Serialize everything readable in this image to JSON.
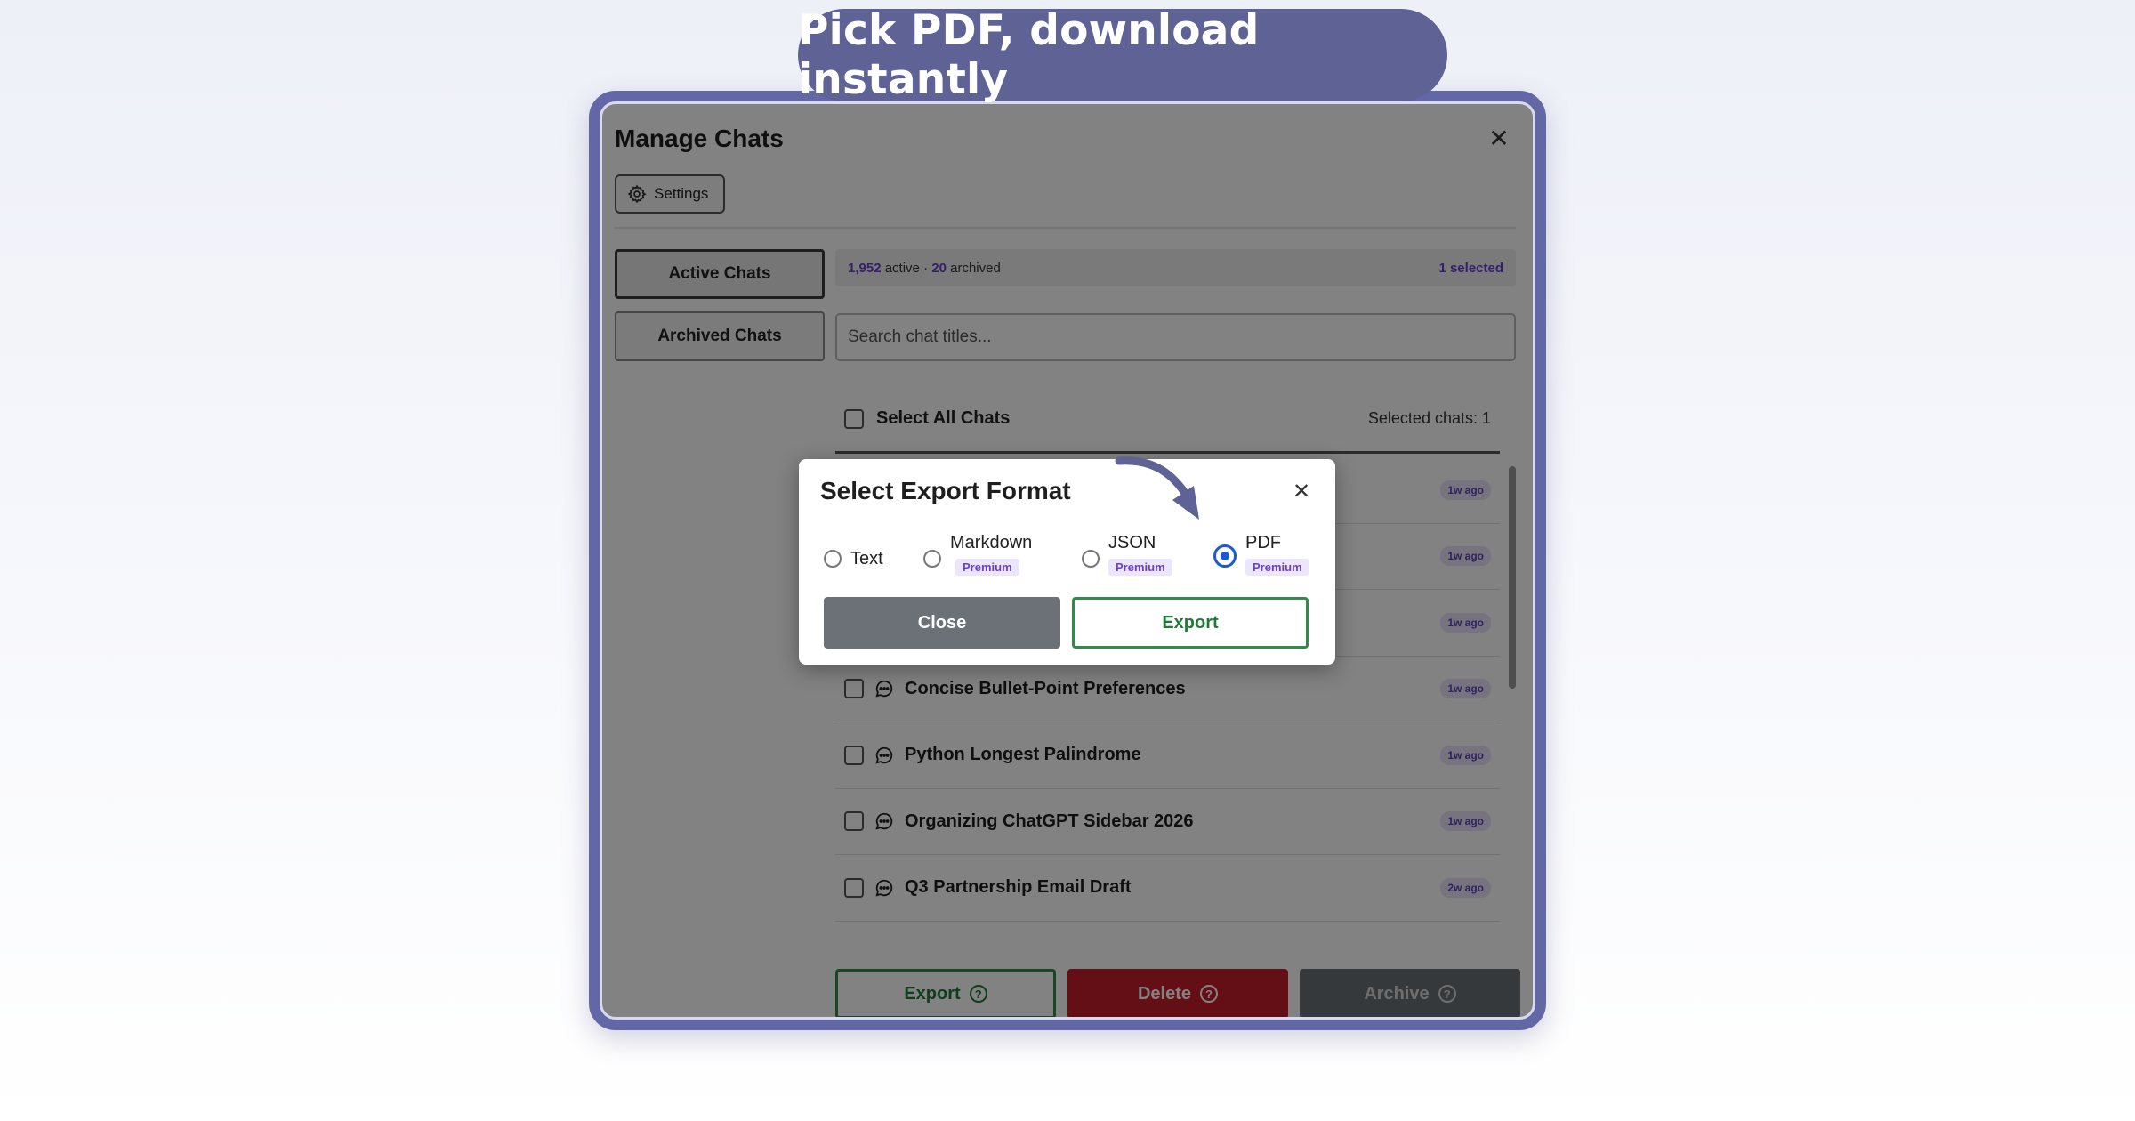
{
  "banner": {
    "text": "Pick PDF, download instantly"
  },
  "panel": {
    "title": "Manage Chats",
    "settings_label": "Settings",
    "tabs": [
      {
        "label": "Active Chats",
        "active": true
      },
      {
        "label": "Archived Chats",
        "active": false
      }
    ],
    "stats": {
      "active_count": "1,952",
      "active_label": "active ·",
      "archived_count": "20",
      "archived_label": "archived",
      "selected": "1 selected"
    },
    "search_placeholder": "Search chat titles...",
    "select_all_label": "Select All Chats",
    "selected_chats": "Selected chats: 1",
    "chats": [
      {
        "title": "",
        "time": "1w ago"
      },
      {
        "title": "",
        "time": "1w ago"
      },
      {
        "title": "",
        "time": "1w ago"
      },
      {
        "title": "Concise Bullet-Point Preferences",
        "time": "1w ago"
      },
      {
        "title": "Python Longest Palindrome",
        "time": "1w ago"
      },
      {
        "title": "Organizing ChatGPT Sidebar 2026",
        "time": "1w ago"
      },
      {
        "title": "Q3 Partnership Email Draft",
        "time": "2w ago"
      }
    ],
    "actions": {
      "export": "Export",
      "delete": "Delete",
      "archive": "Archive"
    }
  },
  "modal": {
    "title": "Select Export Format",
    "options": [
      {
        "label": "Text",
        "premium": "",
        "checked": false
      },
      {
        "label": "Markdown",
        "premium": "Premium",
        "checked": false
      },
      {
        "label": "JSON",
        "premium": "Premium",
        "checked": false
      },
      {
        "label": "PDF",
        "premium": "Premium",
        "checked": true
      }
    ],
    "close_label": "Close",
    "export_label": "Export"
  },
  "colors": {
    "accent_purple": "#6a3fd0",
    "frame": "#6268a6",
    "export_green": "#2f8d45",
    "delete_red": "#c51f2b",
    "radio_blue": "#1a59d6"
  }
}
